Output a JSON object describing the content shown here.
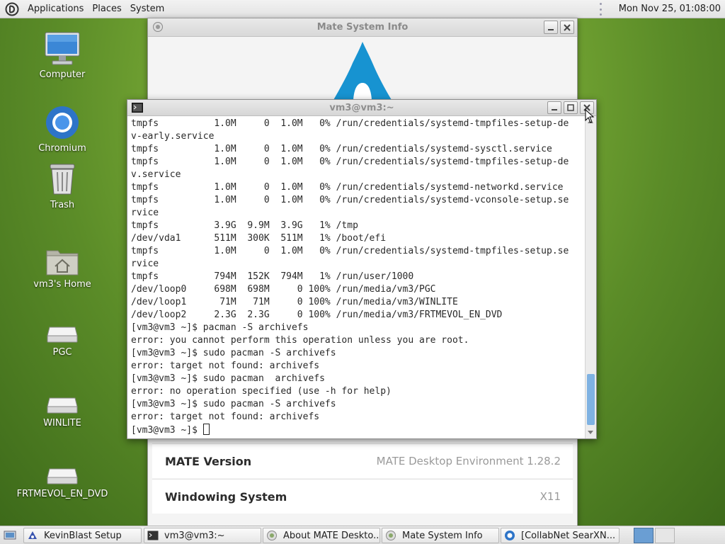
{
  "top_panel": {
    "menus": [
      "Applications",
      "Places",
      "System"
    ],
    "clock": "Mon Nov 25, 01:08:00"
  },
  "desktop_icons": [
    {
      "label": "Computer",
      "icon": "computer-icon"
    },
    {
      "label": "Chromium",
      "icon": "chromium-icon"
    },
    {
      "label": "Trash",
      "icon": "trash-icon"
    },
    {
      "label": "vm3's Home",
      "icon": "home-folder-icon"
    },
    {
      "label": "PGC",
      "icon": "drive-icon"
    },
    {
      "label": "WINLITE",
      "icon": "drive-icon"
    },
    {
      "label": "FRTMEVOL_EN_DVD",
      "icon": "drive-icon"
    }
  ],
  "info_window": {
    "title": "Mate System Info",
    "rows": [
      {
        "key": "MATE Version",
        "value": "MATE Desktop Environment 1.28.2"
      },
      {
        "key": "Windowing System",
        "value": "X11"
      }
    ]
  },
  "terminal": {
    "title": "vm3@vm3:~",
    "lines": [
      "tmpfs          1.0M     0  1.0M   0% /run/credentials/systemd-tmpfiles-setup-de",
      "v-early.service",
      "tmpfs          1.0M     0  1.0M   0% /run/credentials/systemd-sysctl.service",
      "tmpfs          1.0M     0  1.0M   0% /run/credentials/systemd-tmpfiles-setup-de",
      "v.service",
      "tmpfs          1.0M     0  1.0M   0% /run/credentials/systemd-networkd.service",
      "tmpfs          1.0M     0  1.0M   0% /run/credentials/systemd-vconsole-setup.se",
      "rvice",
      "tmpfs          3.9G  9.9M  3.9G   1% /tmp",
      "/dev/vda1      511M  300K  511M   1% /boot/efi",
      "tmpfs          1.0M     0  1.0M   0% /run/credentials/systemd-tmpfiles-setup.se",
      "rvice",
      "tmpfs          794M  152K  794M   1% /run/user/1000",
      "/dev/loop0     698M  698M     0 100% /run/media/vm3/PGC",
      "/dev/loop1      71M   71M     0 100% /run/media/vm3/WINLITE",
      "/dev/loop2     2.3G  2.3G     0 100% /run/media/vm3/FRTMEVOL_EN_DVD",
      "[vm3@vm3 ~]$ pacman -S archivefs",
      "error: you cannot perform this operation unless you are root.",
      "[vm3@vm3 ~]$ sudo pacman -S archivefs",
      "error: target not found: archivefs",
      "[vm3@vm3 ~]$ sudo pacman  archivefs",
      "error: no operation specified (use -h for help)",
      "[vm3@vm3 ~]$ sudo pacman -S archivefs",
      "error: target not found: archivefs"
    ],
    "prompt": "[vm3@vm3 ~]$ "
  },
  "taskbar": {
    "items": [
      {
        "label": "KevinBlast Setup",
        "icon": "installer-icon"
      },
      {
        "label": "vm3@vm3:~",
        "icon": "terminal-icon"
      },
      {
        "label": "About MATE Deskto...",
        "icon": "mate-icon"
      },
      {
        "label": "Mate System Info",
        "icon": "mate-icon"
      },
      {
        "label": "[CollabNet SearXN...",
        "icon": "chromium-icon"
      }
    ]
  },
  "colors": {
    "scroll_thumb": "#7fb2e2",
    "workspace_active": "#6a9ed3"
  }
}
